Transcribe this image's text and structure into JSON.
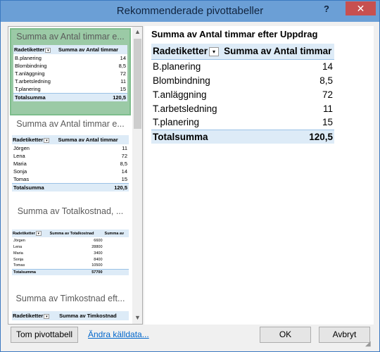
{
  "window": {
    "title": "Rekommenderade pivottabeller",
    "help": "?",
    "close": "✕"
  },
  "thumbnails": [
    {
      "title": "Summa av Antal timmar e...",
      "header": [
        "Radetiketter",
        "Summa av Antal timmar"
      ],
      "rows": [
        [
          "B.planering",
          "14"
        ],
        [
          "Blombindning",
          "8,5"
        ],
        [
          "T.anläggning",
          "72"
        ],
        [
          "T.arbetsledning",
          "11"
        ],
        [
          "T.planering",
          "15"
        ]
      ],
      "total": [
        "Totalsumma",
        "120,5"
      ]
    },
    {
      "title": "Summa av Antal timmar e...",
      "header": [
        "Radetiketter",
        "Summa av Antal timmar"
      ],
      "rows": [
        [
          "Jörgen",
          "11"
        ],
        [
          "Lena",
          "72"
        ],
        [
          "Maria",
          "8,5"
        ],
        [
          "Sonja",
          "14"
        ],
        [
          "Tomas",
          "15"
        ]
      ],
      "total": [
        "Totalsumma",
        "120,5"
      ]
    },
    {
      "title": "Summa av Totalkostnad, ...",
      "header": [
        "Radetiketter",
        "Summa av Totalkostnad",
        "Summa av"
      ],
      "rows": [
        [
          "Jörgen",
          "6600"
        ],
        [
          "Lena",
          "28800"
        ],
        [
          "Maria",
          "3400"
        ],
        [
          "Sonja",
          "8400"
        ],
        [
          "Tomas",
          "10500"
        ]
      ],
      "total": [
        "Totalsumma",
        "57700"
      ]
    },
    {
      "title": "Summa av Timkostnad eft...",
      "header": [
        "Radetiketter",
        "Summa av Timkostnad"
      ]
    }
  ],
  "preview": {
    "title": "Summa av Antal timmar efter Uppdrag",
    "header": [
      "Radetiketter",
      "Summa av Antal timmar"
    ],
    "rows": [
      [
        "B.planering",
        "14"
      ],
      [
        "Blombindning",
        "8,5"
      ],
      [
        "T.anläggning",
        "72"
      ],
      [
        "T.arbetsledning",
        "11"
      ],
      [
        "T.planering",
        "15"
      ]
    ],
    "total": [
      "Totalsumma",
      "120,5"
    ]
  },
  "footer": {
    "blank_pivot_label": "Tom pivottabell",
    "change_source_label": "Ändra källdata...",
    "ok_label": "OK",
    "cancel_label": "Avbryt"
  },
  "icons": {
    "filter": "▾",
    "scroll_up": "▲",
    "scroll_down": "▼",
    "resize": "◢"
  }
}
